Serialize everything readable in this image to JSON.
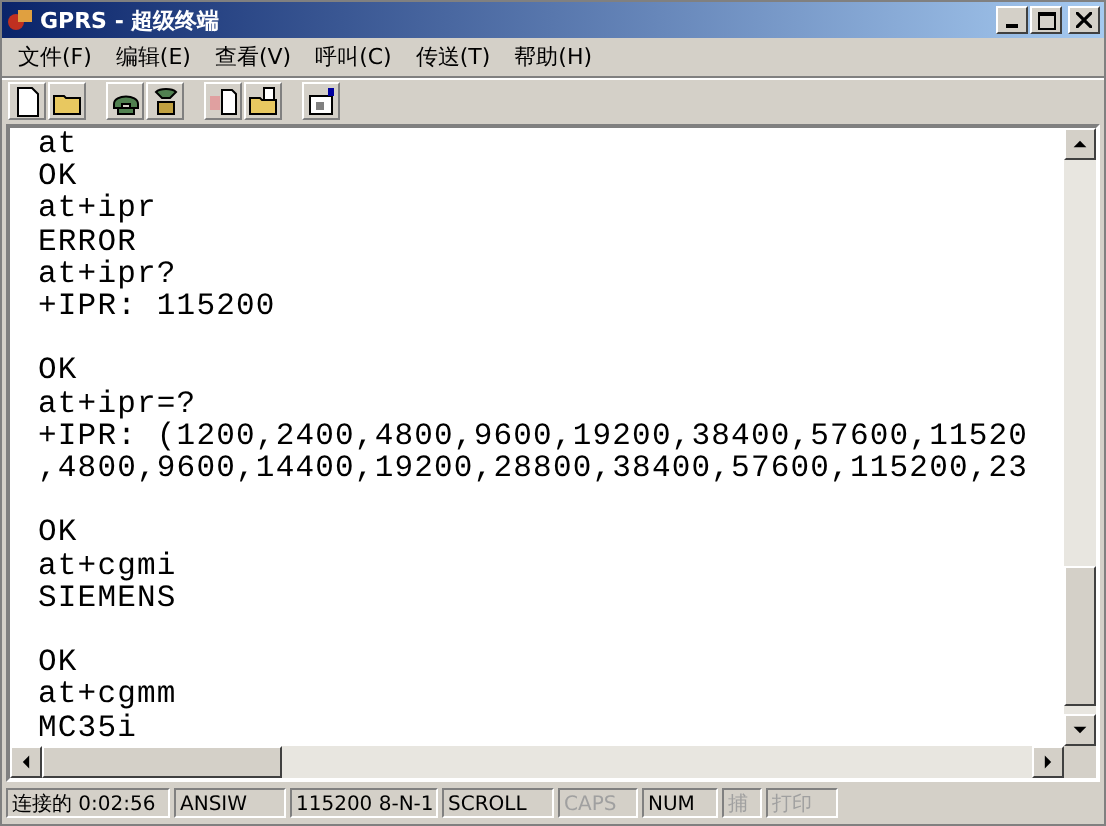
{
  "window": {
    "title": "GPRS - 超级终端"
  },
  "menu": [
    "文件(F)",
    "编辑(E)",
    "查看(V)",
    "呼叫(C)",
    "传送(T)",
    "帮助(H)"
  ],
  "terminal": {
    "blocks": [
      [
        "at",
        "OK",
        "at+ipr",
        "ERROR",
        "at+ipr?",
        "+IPR: 115200"
      ],
      [
        "OK",
        "at+ipr=?",
        "+IPR: (1200,2400,4800,9600,19200,38400,57600,11520",
        ",4800,9600,14400,19200,28800,38400,57600,115200,23"
      ],
      [
        "OK",
        "at+cgmi",
        "SIEMENS"
      ],
      [
        "OK",
        "at+cgmm",
        "MC35i"
      ]
    ]
  },
  "status_bar": [
    {
      "text": "连接的 0:02:56",
      "disabled": false
    },
    {
      "text": "ANSIW",
      "disabled": false
    },
    {
      "text": "115200 8-N-1",
      "disabled": false
    },
    {
      "text": "SCROLL",
      "disabled": false
    },
    {
      "text": "CAPS",
      "disabled": true
    },
    {
      "text": "NUM",
      "disabled": false
    },
    {
      "text": "捕",
      "disabled": true
    },
    {
      "text": "打印",
      "disabled": true
    }
  ]
}
